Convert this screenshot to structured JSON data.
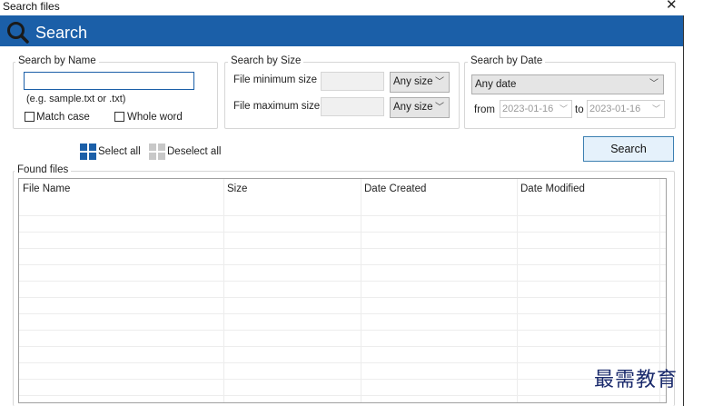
{
  "window": {
    "title": "Search files",
    "close_icon": "close-icon"
  },
  "banner": {
    "title": "Search",
    "icon": "search-icon",
    "color": "#1b5fa8"
  },
  "by_name": {
    "legend": "Search by Name",
    "input_value": "",
    "hint": "(e.g. sample.txt or .txt)",
    "match_case": "Match case",
    "whole_word": "Whole word"
  },
  "by_size": {
    "legend": "Search by Size",
    "min_label": "File minimum size",
    "max_label": "File maximum size",
    "min_unit": "Any size",
    "max_unit": "Any size"
  },
  "by_date": {
    "legend": "Search by Date",
    "selected": "Any date",
    "from_label": "from",
    "from_value": "2023-01-16",
    "to_label": "to",
    "to_value": "2023-01-16"
  },
  "actions": {
    "select_all": "Select all",
    "deselect_all": "Deselect all",
    "search": "Search"
  },
  "results": {
    "legend": "Found files",
    "columns": [
      "File Name",
      "Size",
      "Date Created",
      "Date Modified"
    ],
    "rows": []
  },
  "watermark": "最需教育"
}
